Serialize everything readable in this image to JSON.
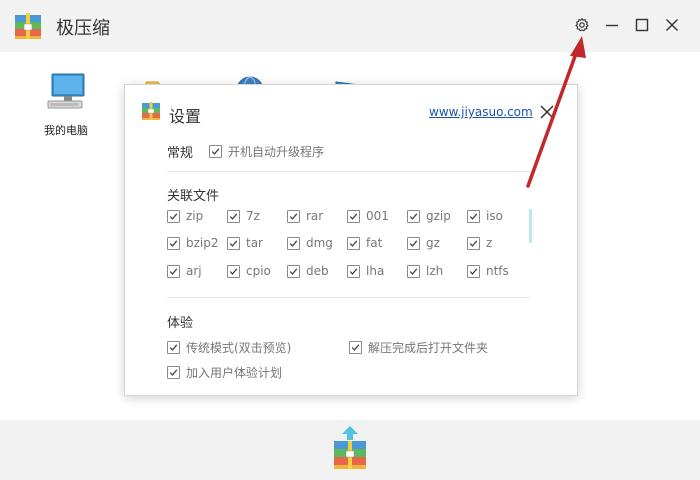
{
  "app": {
    "title": "极压缩"
  },
  "window_controls": {
    "settings": "gear-icon",
    "minimize": "minimize-icon",
    "maximize": "maximize-icon",
    "close": "close-icon"
  },
  "desktop": {
    "icons": [
      {
        "label": "我的电脑",
        "icon": "computer-icon"
      },
      {
        "label": "",
        "icon": "folder-icon"
      },
      {
        "label": "",
        "icon": "network-globe-icon"
      },
      {
        "label": "",
        "icon": "monitor-icon"
      }
    ]
  },
  "settings_dialog": {
    "title": "设置",
    "link": "www.jiyasuo.com",
    "general": {
      "title": "常规",
      "options": [
        {
          "label": "开机自动升级程序",
          "checked": true
        }
      ]
    },
    "associations": {
      "title": "关联文件",
      "rows": [
        [
          {
            "label": "zip",
            "checked": true
          },
          {
            "label": "7z",
            "checked": true
          },
          {
            "label": "rar",
            "checked": true
          },
          {
            "label": "001",
            "checked": true
          },
          {
            "label": "gzip",
            "checked": true
          },
          {
            "label": "iso",
            "checked": true
          }
        ],
        [
          {
            "label": "bzip2",
            "checked": true
          },
          {
            "label": "tar",
            "checked": true
          },
          {
            "label": "dmg",
            "checked": true
          },
          {
            "label": "fat",
            "checked": true
          },
          {
            "label": "gz",
            "checked": true
          },
          {
            "label": "z",
            "checked": true
          }
        ],
        [
          {
            "label": "arj",
            "checked": true
          },
          {
            "label": "cpio",
            "checked": true
          },
          {
            "label": "deb",
            "checked": true
          },
          {
            "label": "lha",
            "checked": true
          },
          {
            "label": "lzh",
            "checked": true
          },
          {
            "label": "ntfs",
            "checked": true
          }
        ]
      ]
    },
    "experience": {
      "title": "体验",
      "options": [
        {
          "label": "传统模式(双击预览)",
          "checked": true
        },
        {
          "label": "解压完成后打开文件夹",
          "checked": true
        },
        {
          "label": "加入用户体验计划",
          "checked": true
        }
      ]
    }
  },
  "colors": {
    "accent_arrow": "#c0282a",
    "link": "#1a55b0",
    "titlebar_bg": "#f2f2f2"
  }
}
